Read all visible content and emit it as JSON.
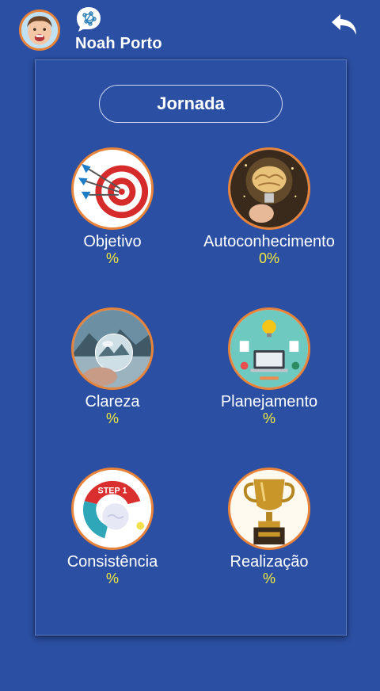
{
  "header": {
    "user_name": "Noah Porto",
    "avatar_icon": "child-avatar",
    "brand_icon": "brain-chat-icon",
    "back_icon": "back-arrow-icon"
  },
  "panel": {
    "title": "Jornada",
    "tiles": [
      {
        "label": "Objetivo",
        "percent": "%",
        "icon": "target-darts-icon"
      },
      {
        "label": "Autoconhecimento",
        "percent": "0%",
        "icon": "brain-lightbulb-icon"
      },
      {
        "label": "Clareza",
        "percent": "%",
        "icon": "crystal-ball-icon"
      },
      {
        "label": "Planejamento",
        "percent": "%",
        "icon": "planning-desk-icon"
      },
      {
        "label": "Consistência",
        "percent": "%",
        "icon": "steps-puzzle-icon"
      },
      {
        "label": "Realização",
        "percent": "%",
        "icon": "trophy-icon"
      }
    ]
  },
  "colors": {
    "background": "#2b4fa3",
    "accent_border": "#e8833a",
    "percent_text": "#f4ea3c"
  }
}
